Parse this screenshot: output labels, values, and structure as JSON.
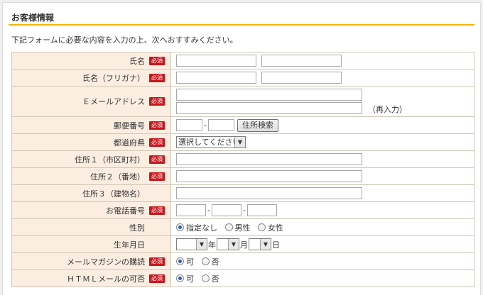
{
  "section": {
    "title": "お客様情報",
    "intro": "下記フォームに必要な内容を入力の上、次へおすすみください。"
  },
  "required_label": "必須",
  "fields": {
    "name": {
      "label": "氏名"
    },
    "name_kana": {
      "label": "氏名（フリガナ）"
    },
    "email": {
      "label": "Ｅメールアドレス",
      "reenter_note": "（再入力）"
    },
    "postal": {
      "label": "郵便番号",
      "search_button": "住所検索",
      "separator": "-"
    },
    "prefecture": {
      "label": "都道府県",
      "selected": "選択してください"
    },
    "address1": {
      "label": "住所１（市区町村）"
    },
    "address2": {
      "label": "住所２（番地）"
    },
    "address3": {
      "label": "住所３（建物名）"
    },
    "phone": {
      "label": "お電話番号",
      "separator": "-"
    },
    "gender": {
      "label": "性別",
      "options": [
        "指定なし",
        "男性",
        "女性"
      ],
      "selected_index": 0
    },
    "birthday": {
      "label": "生年月日",
      "year_unit": "年",
      "month_unit": "月",
      "day_unit": "日"
    },
    "newsletter": {
      "label": "メールマガジンの購読",
      "options": [
        "可",
        "否"
      ],
      "selected_index": 0
    },
    "html_mail": {
      "label": "ＨＴＭＬメールの可否",
      "options": [
        "可",
        "否"
      ],
      "selected_index": 0
    }
  },
  "colors": {
    "accent_line": "#f0b400",
    "label_bg": "#fbeee0",
    "required_badge": "#c8161d"
  }
}
